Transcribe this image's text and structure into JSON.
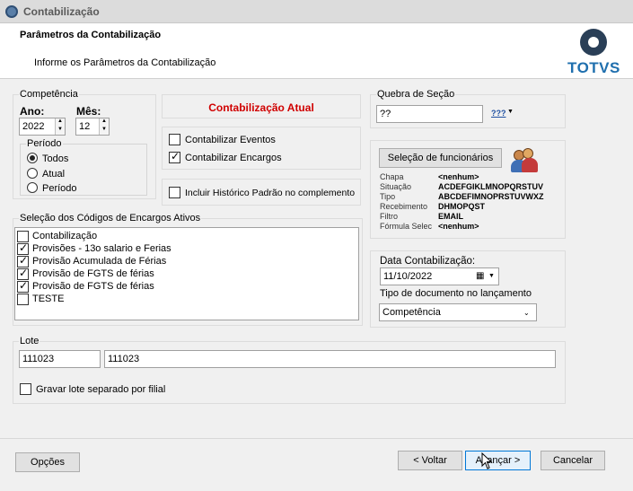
{
  "window": {
    "title": "Contabilização"
  },
  "header": {
    "title": "Parâmetros da Contabilização",
    "subtitle": "Informe os Parâmetros da Contabilização",
    "logo": "TOTVS"
  },
  "competencia": {
    "label": "Competência",
    "ano_label": "Ano:",
    "ano_value": "2022",
    "mes_label": "Mês:",
    "mes_value": "12",
    "periodo": {
      "label": "Período",
      "options": [
        "Todos",
        "Atual",
        "Período"
      ],
      "selected": "Todos"
    }
  },
  "contabilizacao": {
    "atual_label": "Contabilização Atual",
    "atual_color": "#d00000",
    "eventos_label": "Contabilizar Eventos",
    "eventos_checked": false,
    "encargos_label": "Contabilizar Encargos",
    "encargos_checked": true,
    "historico_label": "Incluir Histórico Padrão no complemento",
    "historico_checked": false
  },
  "quebra": {
    "label": "Quebra de Seção",
    "value": "??",
    "lookup_icon": "???"
  },
  "funcionarios": {
    "button_label": "Seleção de funcionários",
    "icon": "people-icon",
    "rows": [
      {
        "label": "Chapa",
        "value": "<nenhum>"
      },
      {
        "label": "Situação",
        "value": "ACDEFGIKLMNOPQRSTUV"
      },
      {
        "label": "Tipo",
        "value": "ABCDEFIMNOPRSTUVWXZ"
      },
      {
        "label": "Recebimento",
        "value": "DHMOPQST"
      },
      {
        "label": "Filtro",
        "value": "EMAIL"
      },
      {
        "label": "Fórmula Selec",
        "value": "<nenhum>"
      }
    ]
  },
  "encargos": {
    "label": "Seleção dos Códigos de Encargos Ativos",
    "items": [
      {
        "label": "Contabilização",
        "checked": false
      },
      {
        "label": "Provisões - 13o salario e Ferias",
        "checked": true
      },
      {
        "label": "Provisão Acumulada de Férias",
        "checked": true
      },
      {
        "label": "Provisão de FGTS de férias",
        "checked": true
      },
      {
        "label": "Provisão de FGTS de férias",
        "checked": true
      },
      {
        "label": "TESTE",
        "checked": false
      }
    ]
  },
  "data_contab": {
    "label": "Data Contabilização:",
    "value": "11/10/2022",
    "tipo_label": "Tipo de documento no lançamento",
    "tipo_value": "Competência"
  },
  "lote": {
    "label": "Lote",
    "value1": "111023",
    "value2": "111023",
    "separado_label": "Gravar lote separado por filial",
    "separado_checked": false
  },
  "footer": {
    "opcoes": "Opções",
    "voltar": "< Voltar",
    "avancar": "Avançar >",
    "cancelar": "Cancelar"
  }
}
